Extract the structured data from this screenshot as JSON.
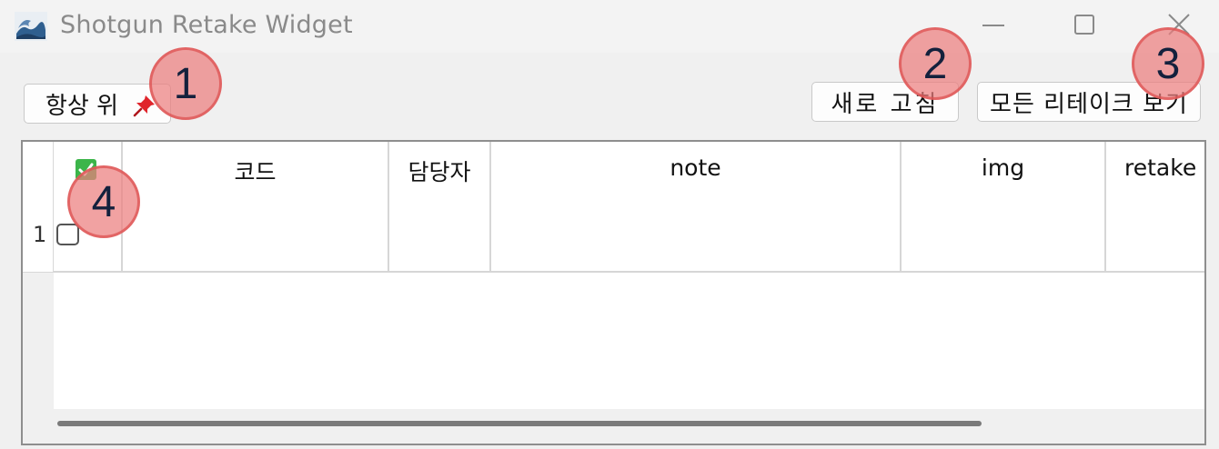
{
  "window": {
    "title": "Shotgun Retake Widget",
    "icon": "app-wave-icon",
    "controls": [
      "minimize-icon",
      "maximize-icon",
      "close-icon"
    ]
  },
  "toolbar": {
    "always_on_top_label": "항상 위",
    "pin_icon": "pin-icon",
    "refresh_label": "새로 고침",
    "view_all_label": "모든 리테이크 보기"
  },
  "table": {
    "columns": [
      "",
      "코드",
      "담당자",
      "note",
      "img",
      "retake"
    ],
    "rows": [
      {
        "row_number": "1",
        "checked": false,
        "code": "",
        "assignee": "",
        "note": "",
        "img": "",
        "retake": ""
      }
    ],
    "header_checkbox_checked": true
  },
  "markers": [
    "1",
    "2",
    "3",
    "4"
  ],
  "colors": {
    "header_check": "#3cb54a",
    "marker_fill": "#ec7e7e",
    "marker_text": "#14213d",
    "pin": "#e0242b"
  }
}
